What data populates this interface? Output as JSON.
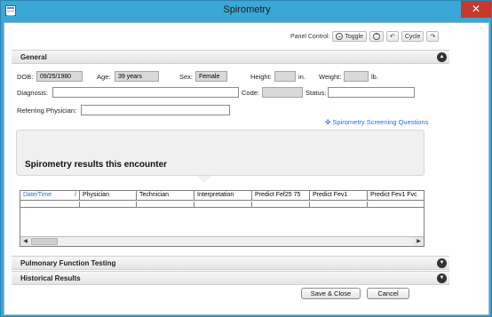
{
  "window": {
    "title": "Spirometry",
    "close_glyph": "✕"
  },
  "panel_control": {
    "label": "Panel Control:",
    "toggle_label": "Toggle",
    "cycle_label": "Cycle"
  },
  "general": {
    "title": "General",
    "dob_label": "DOB:",
    "dob_value": "09/25/1980",
    "age_label": "Age:",
    "age_value": "39 years",
    "sex_label": "Sex:",
    "sex_value": "Female",
    "height_label": "Height:",
    "height_unit": "in.",
    "weight_label": "Weight:",
    "weight_unit": "lb.",
    "diagnosis_label": "Diagnosis:",
    "code_label": "Code:",
    "status_label": "Status:",
    "referring_label": "Referring Physician:"
  },
  "screening_link": "Spirometry Screening Questions",
  "results": {
    "title": "Spirometry results this encounter",
    "columns": [
      "Date/Time",
      "Physician",
      "Technician",
      "Interpretation",
      "Predict Fef25 75",
      "Predict Fev1",
      "Predict Fev1 Fvc"
    ],
    "sort_glyph": "/"
  },
  "sections": {
    "pulmonary": "Pulmonary Function Testing",
    "historical": "Historical Results"
  },
  "buttons": {
    "save_close": "Save & Close",
    "cancel": "Cancel"
  },
  "colors": {
    "titlebar": "#3aa7d6",
    "close": "#c7392d",
    "link": "#2c6cd0"
  }
}
